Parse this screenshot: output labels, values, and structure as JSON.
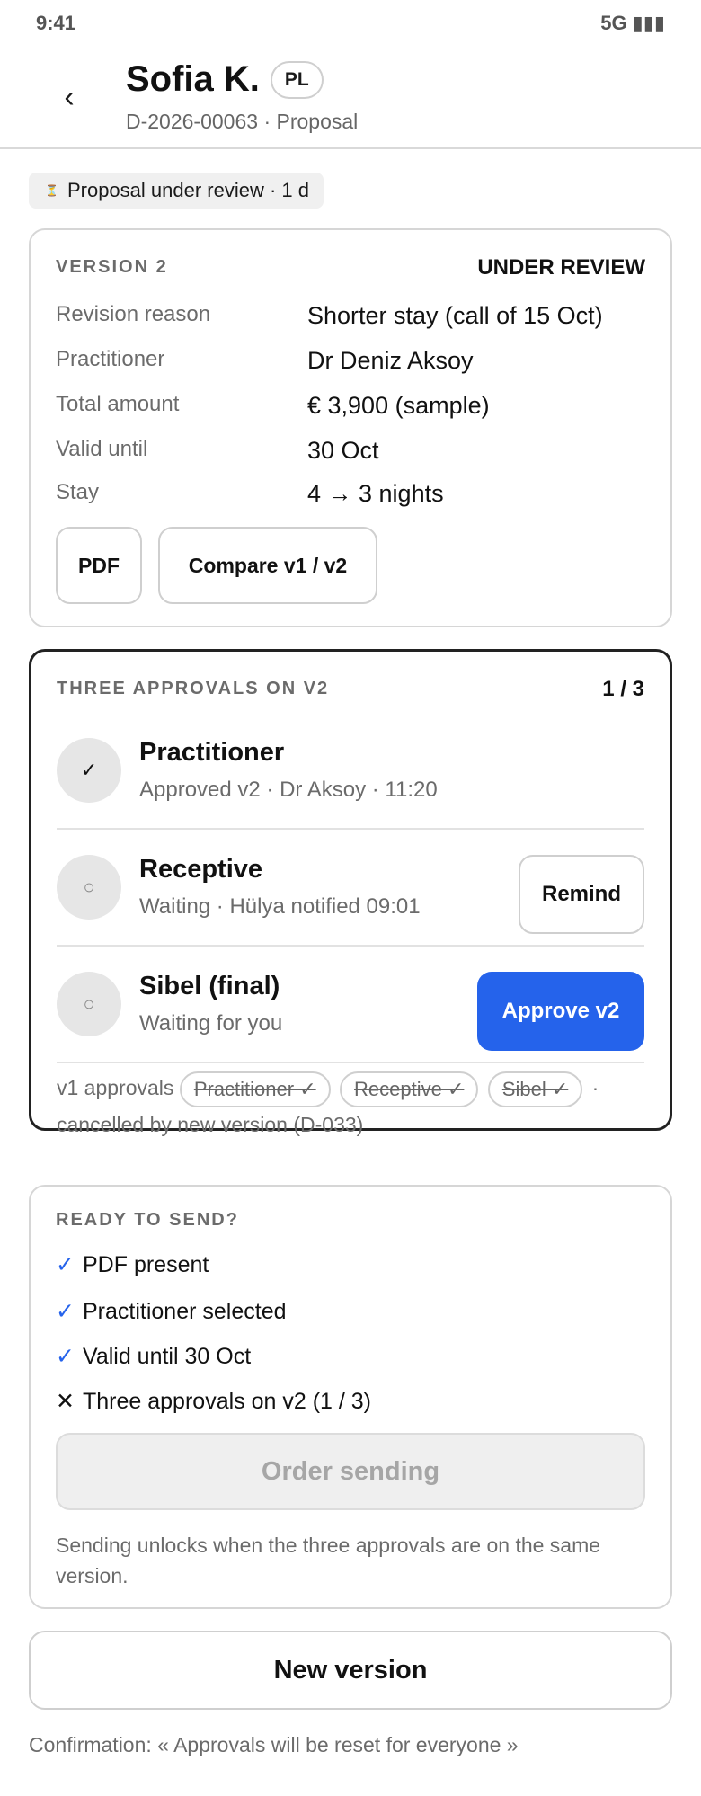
{
  "status_bar": {
    "time": "9:41",
    "signal": "5G ▮▮▮"
  },
  "header": {
    "back_icon": "chevron-left-icon",
    "title": "Sofia K.",
    "lang_badge": "PL",
    "subtitle": "D-2026-00063 · Proposal"
  },
  "status_pill": {
    "icon": "hourglass-icon",
    "text": "Proposal under review · 1 d"
  },
  "version_card": {
    "label": "VERSION 2",
    "state": "UNDER REVIEW",
    "fields": [
      {
        "key": "Revision reason",
        "value": "Shorter stay (call of 15 Oct)"
      },
      {
        "key": "Practitioner",
        "value": "Dr Deniz Aksoy"
      },
      {
        "key": "Total amount",
        "value": "€ 3,900 (sample)"
      },
      {
        "key": "Valid until",
        "value": "30 Oct"
      },
      {
        "key": "Stay",
        "value": "4 → 3 nights"
      }
    ],
    "pdf_button": "PDF",
    "compare_button": "Compare v1 / v2"
  },
  "approvals": {
    "label": "THREE APPROVALS ON V2",
    "count": "1 / 3",
    "items": [
      {
        "icon": "✓",
        "name": "Practitioner",
        "status": "Approved v2 · Dr Aksoy · 11:20"
      },
      {
        "icon": "○",
        "name": "Receptive",
        "status": "Waiting · Hülya notified 09:01",
        "action": "Remind"
      },
      {
        "icon": "○",
        "name": "Sibel (final)",
        "status": "Waiting for you",
        "action": "Approve v2"
      }
    ],
    "v1_prefix": "v1 approvals",
    "v1_chips": [
      "Practitioner ✓",
      "Receptive ✓",
      "Sibel ✓"
    ],
    "v1_suffix": "· cancelled by new version (D-033)"
  },
  "ready": {
    "label": "READY TO SEND?",
    "checks": [
      {
        "mark": "✓",
        "ok": true,
        "text": "PDF present"
      },
      {
        "mark": "✓",
        "ok": true,
        "text": "Practitioner selected"
      },
      {
        "mark": "✓",
        "ok": true,
        "text": "Valid until 30 Oct"
      },
      {
        "mark": "✕",
        "ok": false,
        "text": "Three approvals on v2 (1 / 3)"
      }
    ],
    "order_button": "Order sending",
    "note": "Sending unlocks when the three approvals are on the same version."
  },
  "new_version_button": "New version",
  "confirmation": "Confirmation: « Approvals will be reset for everyone »",
  "colors": {
    "accent": "#2563eb",
    "disabled_bg": "#efefef"
  }
}
